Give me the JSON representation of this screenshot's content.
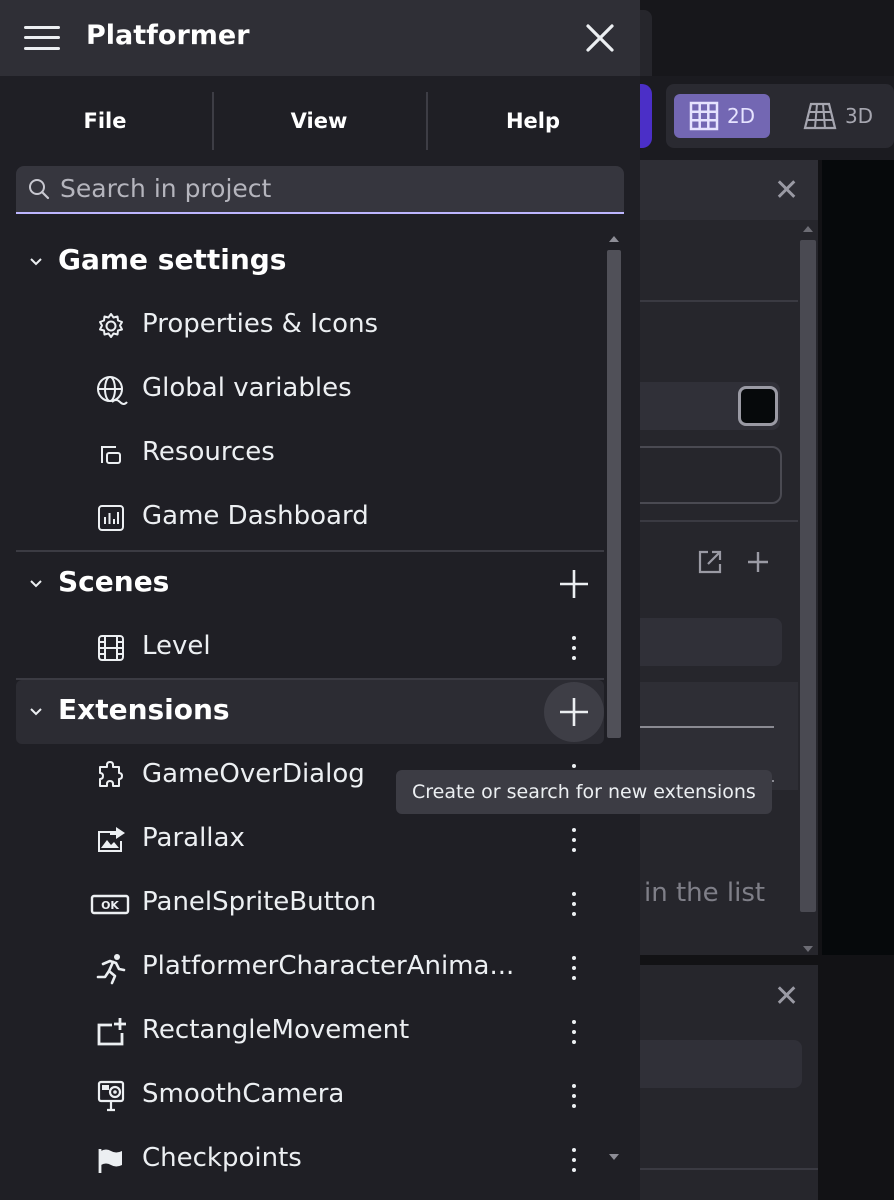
{
  "app": {
    "title": "Platformer"
  },
  "menu": {
    "file": "File",
    "view": "View",
    "help": "Help"
  },
  "search": {
    "placeholder": "Search in project"
  },
  "sections": {
    "game_settings": {
      "title": "Game settings",
      "items": [
        {
          "label": "Properties & Icons",
          "icon": "gear-icon"
        },
        {
          "label": "Global variables",
          "icon": "globe-icon"
        },
        {
          "label": "Resources",
          "icon": "resources-icon"
        },
        {
          "label": "Game Dashboard",
          "icon": "dashboard-icon"
        }
      ]
    },
    "scenes": {
      "title": "Scenes",
      "items": [
        {
          "label": "Level",
          "icon": "film-icon"
        }
      ]
    },
    "extensions": {
      "title": "Extensions",
      "items": [
        {
          "label": "GameOverDialog",
          "icon": "puzzle-icon"
        },
        {
          "label": "Parallax",
          "icon": "image-arrow-icon"
        },
        {
          "label": "PanelSpriteButton",
          "icon": "ok-button-icon"
        },
        {
          "label": "PlatformerCharacterAnima...",
          "icon": "running-person-icon"
        },
        {
          "label": "RectangleMovement",
          "icon": "rectangle-plus-icon"
        },
        {
          "label": "SmoothCamera",
          "icon": "camera-icon"
        },
        {
          "label": "Checkpoints",
          "icon": "flag-icon"
        }
      ]
    }
  },
  "tooltip": {
    "text": "Create or search for new extensions"
  },
  "background": {
    "toolbar": {
      "mode_2d": "2D",
      "mode_3d": "3D"
    },
    "panel_text": "in the list"
  },
  "colors": {
    "accent": "#bdb6ff",
    "drawer_bg": "#1f1f25",
    "header_bg": "#2f2f36",
    "active_2d": "#7367b3"
  }
}
